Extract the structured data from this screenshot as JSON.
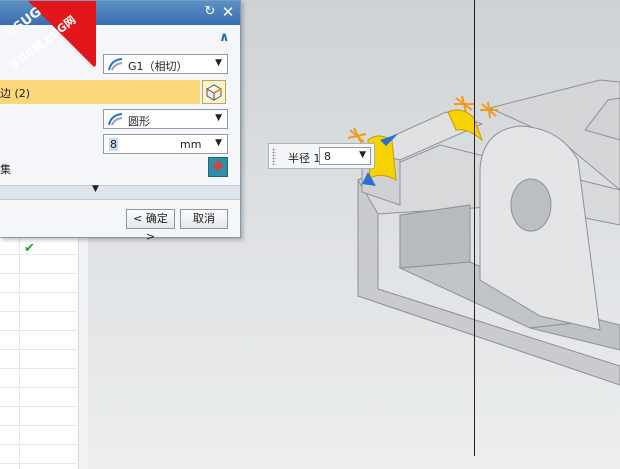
{
  "watermark": {
    "line1": "9SUG",
    "line2": "学UG就上UG网"
  },
  "dialog": {
    "continuity": {
      "value": "G1（相切）",
      "icon": "curve-continuity-icon"
    },
    "edge_selection": {
      "label": "边 (2)",
      "icon": "select-edge-cube-icon"
    },
    "shape": {
      "value": "圆形",
      "icon": "curve-shape-icon"
    },
    "radius": {
      "value": "8",
      "unit": "mm"
    },
    "new_set_label": "集",
    "buttons": {
      "ok": "< 确定 >",
      "cancel": "取消"
    }
  },
  "navigator": {
    "status_icon": "check-icon"
  },
  "floating_input": {
    "label": "半径 1",
    "value": "8"
  },
  "colors": {
    "title_bar": "#3a6fae",
    "selection_highlight": "#fcd87a",
    "watermark_red": "#e3161c",
    "handle_orange": "#f39a1e",
    "edge_yellow": "#f5c400"
  }
}
